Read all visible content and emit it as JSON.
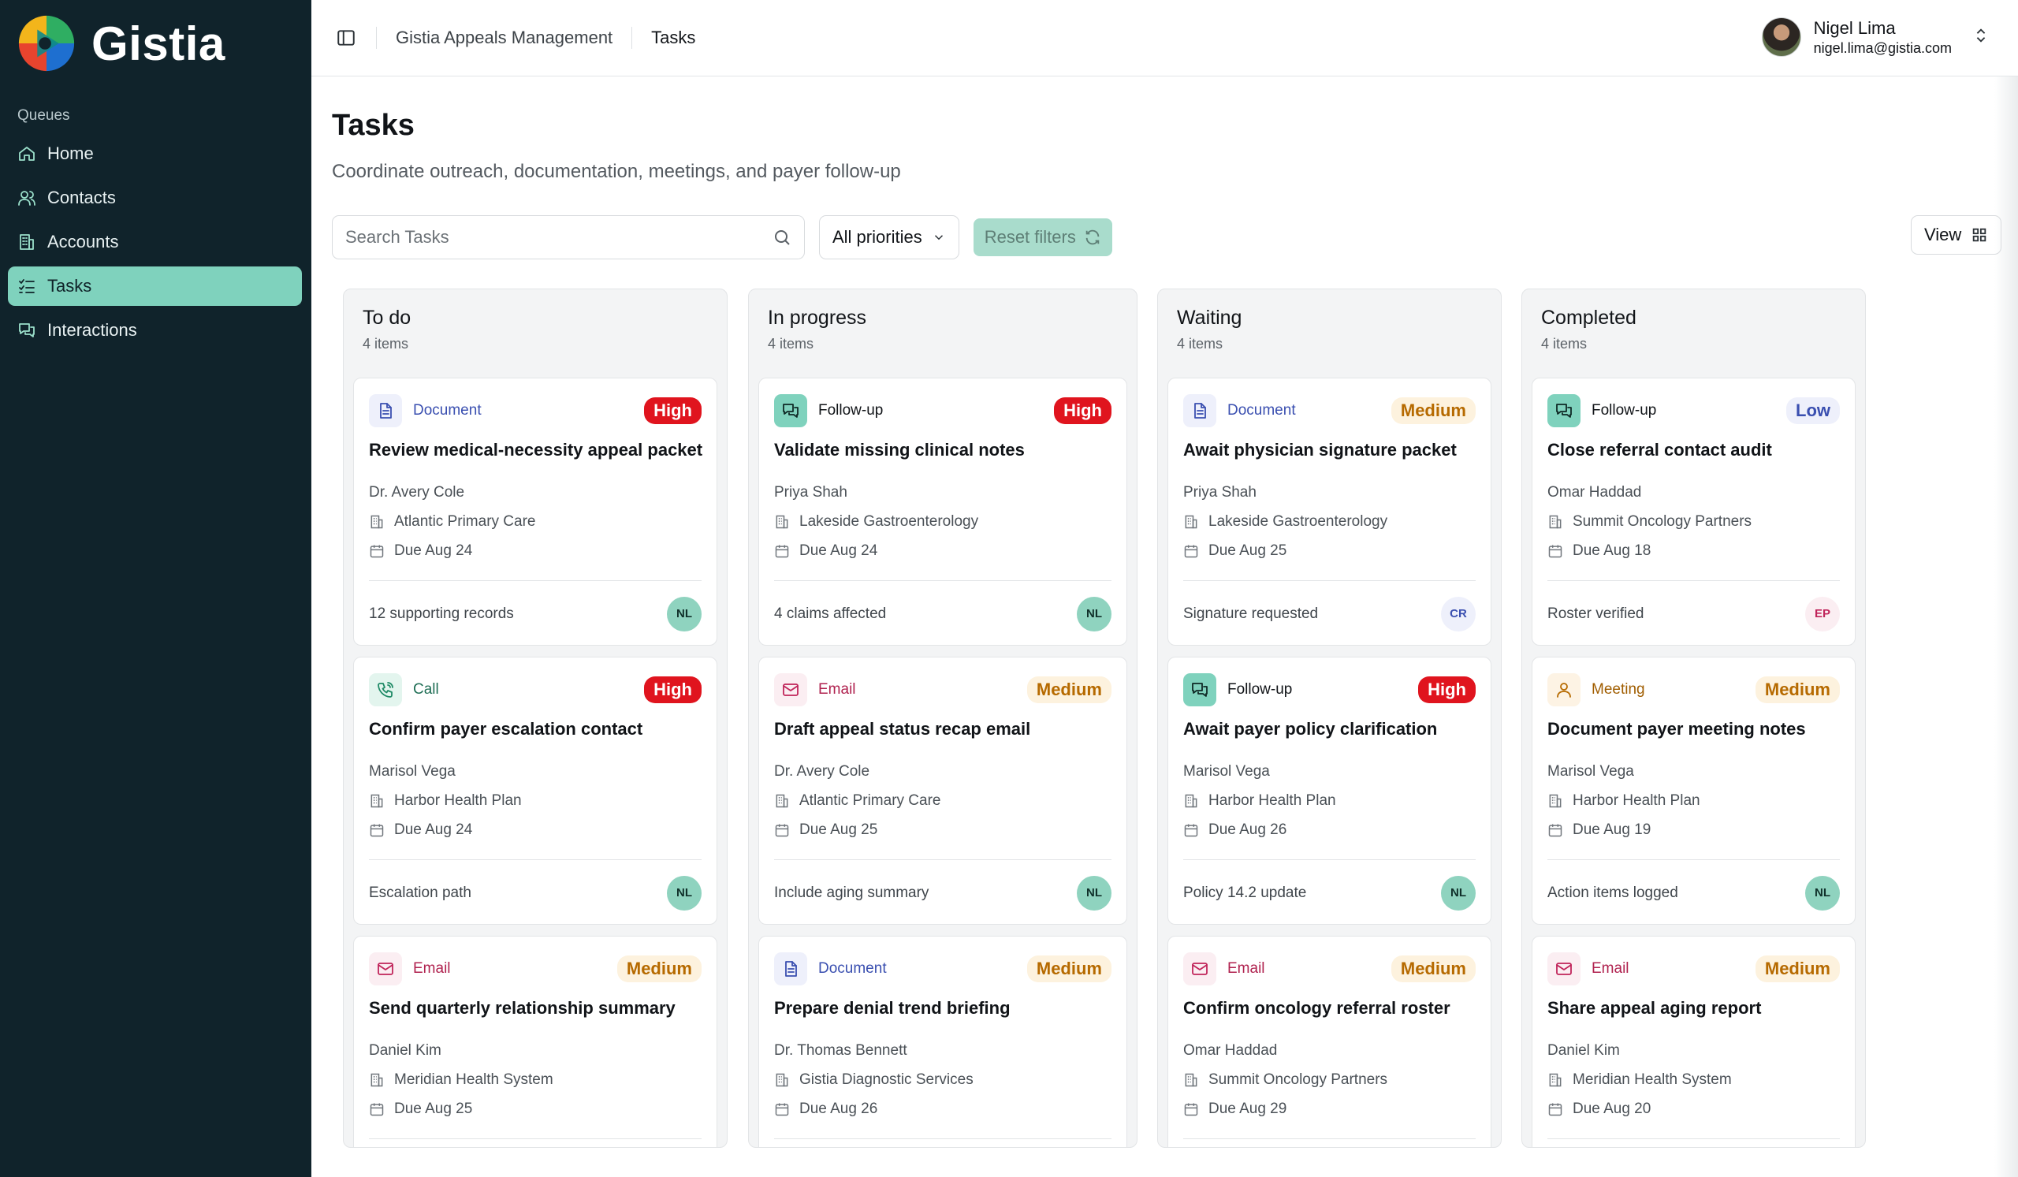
{
  "app": {
    "name": "Gistia"
  },
  "sidebar": {
    "section_label": "Queues",
    "items": [
      {
        "label": "Home",
        "icon": "home-icon",
        "active": false
      },
      {
        "label": "Contacts",
        "icon": "users-icon",
        "active": false
      },
      {
        "label": "Accounts",
        "icon": "building-icon",
        "active": false
      },
      {
        "label": "Tasks",
        "icon": "list-checks-icon",
        "active": true
      },
      {
        "label": "Interactions",
        "icon": "messages-icon",
        "active": false
      }
    ]
  },
  "header": {
    "breadcrumb": [
      "Gistia Appeals Management",
      "Tasks"
    ],
    "user": {
      "name": "Nigel Lima",
      "email": "nigel.lima@gistia.com"
    }
  },
  "page": {
    "title": "Tasks",
    "subtitle": "Coordinate outreach, documentation, meetings, and payer follow-up"
  },
  "toolbar": {
    "search_placeholder": "Search Tasks",
    "priority_filter": "All priorities",
    "reset_label": "Reset filters",
    "view_label": "View"
  },
  "colors": {
    "sidebar_bg": "#10232b",
    "accent": "#7fd2bd",
    "high": "#e0141e",
    "medium": "#b66a00",
    "low": "#3a4fb0"
  },
  "columns": [
    {
      "title": "To do",
      "count": "4 items",
      "cards": [
        {
          "type": "Document",
          "priority": "High",
          "title": "Review medical-necessity appeal packet",
          "contact": "Dr. Avery Cole",
          "account": "Atlantic Primary Care",
          "due": "Due Aug 24",
          "footer": "12 supporting records",
          "assignee": "NL"
        },
        {
          "type": "Call",
          "priority": "High",
          "title": "Confirm payer escalation contact",
          "contact": "Marisol Vega",
          "account": "Harbor Health Plan",
          "due": "Due Aug 24",
          "footer": "Escalation path",
          "assignee": "NL"
        },
        {
          "type": "Email",
          "priority": "Medium",
          "title": "Send quarterly relationship summary",
          "contact": "Daniel Kim",
          "account": "Meridian Health System",
          "due": "Due Aug 25",
          "footer": "",
          "assignee": ""
        }
      ]
    },
    {
      "title": "In progress",
      "count": "4 items",
      "cards": [
        {
          "type": "Follow-up",
          "priority": "High",
          "title": "Validate missing clinical notes",
          "contact": "Priya Shah",
          "account": "Lakeside Gastroenterology",
          "due": "Due Aug 24",
          "footer": "4 claims affected",
          "assignee": "NL"
        },
        {
          "type": "Email",
          "priority": "Medium",
          "title": "Draft appeal status recap email",
          "contact": "Dr. Avery Cole",
          "account": "Atlantic Primary Care",
          "due": "Due Aug 25",
          "footer": "Include aging summary",
          "assignee": "NL"
        },
        {
          "type": "Document",
          "priority": "Medium",
          "title": "Prepare denial trend briefing",
          "contact": "Dr. Thomas Bennett",
          "account": "Gistia Diagnostic Services",
          "due": "Due Aug 26",
          "footer": "",
          "assignee": ""
        }
      ]
    },
    {
      "title": "Waiting",
      "count": "4 items",
      "cards": [
        {
          "type": "Document",
          "priority": "Medium",
          "title": "Await physician signature packet",
          "contact": "Priya Shah",
          "account": "Lakeside Gastroenterology",
          "due": "Due Aug 25",
          "footer": "Signature requested",
          "assignee": "CR"
        },
        {
          "type": "Follow-up",
          "priority": "High",
          "title": "Await payer policy clarification",
          "contact": "Marisol Vega",
          "account": "Harbor Health Plan",
          "due": "Due Aug 26",
          "footer": "Policy 14.2 update",
          "assignee": "NL"
        },
        {
          "type": "Email",
          "priority": "Medium",
          "title": "Confirm oncology referral roster",
          "contact": "Omar Haddad",
          "account": "Summit Oncology Partners",
          "due": "Due Aug 29",
          "footer": "",
          "assignee": ""
        }
      ]
    },
    {
      "title": "Completed",
      "count": "4 items",
      "cards": [
        {
          "type": "Follow-up",
          "priority": "Low",
          "title": "Close referral contact audit",
          "contact": "Omar Haddad",
          "account": "Summit Oncology Partners",
          "due": "Due Aug 18",
          "footer": "Roster verified",
          "assignee": "EP"
        },
        {
          "type": "Meeting",
          "priority": "Medium",
          "title": "Document payer meeting notes",
          "contact": "Marisol Vega",
          "account": "Harbor Health Plan",
          "due": "Due Aug 19",
          "footer": "Action items logged",
          "assignee": "NL"
        },
        {
          "type": "Email",
          "priority": "Medium",
          "title": "Share appeal aging report",
          "contact": "Daniel Kim",
          "account": "Meridian Health System",
          "due": "Due Aug 20",
          "footer": "",
          "assignee": ""
        }
      ]
    }
  ]
}
